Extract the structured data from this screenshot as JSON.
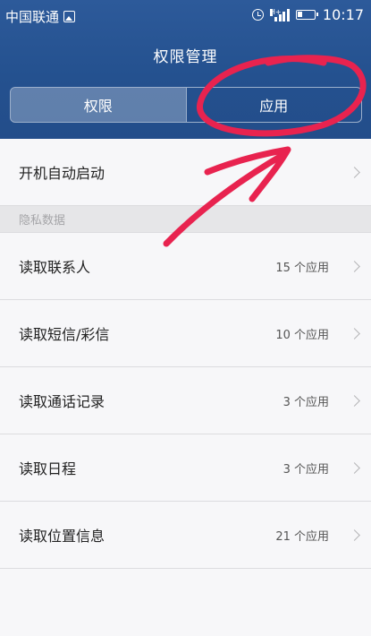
{
  "status_bar": {
    "carrier": "中国联通",
    "signal_label": "H+",
    "time": "10:17"
  },
  "header": {
    "title": "权限管理",
    "tabs": [
      {
        "label": "权限",
        "active": true
      },
      {
        "label": "应用",
        "active": false
      }
    ]
  },
  "rows_top": [
    {
      "label": "开机自动启动"
    }
  ],
  "section": {
    "title": "隐私数据"
  },
  "privacy_rows": [
    {
      "label": "读取联系人",
      "count": "15 个应用"
    },
    {
      "label": "读取短信/彩信",
      "count": "10 个应用"
    },
    {
      "label": "读取通话记录",
      "count": "3 个应用"
    },
    {
      "label": "读取日程",
      "count": "3 个应用"
    },
    {
      "label": "读取位置信息",
      "count": "21 个应用"
    }
  ],
  "colors": {
    "header_bg": "#24518f",
    "annotation": "#e8234f"
  }
}
